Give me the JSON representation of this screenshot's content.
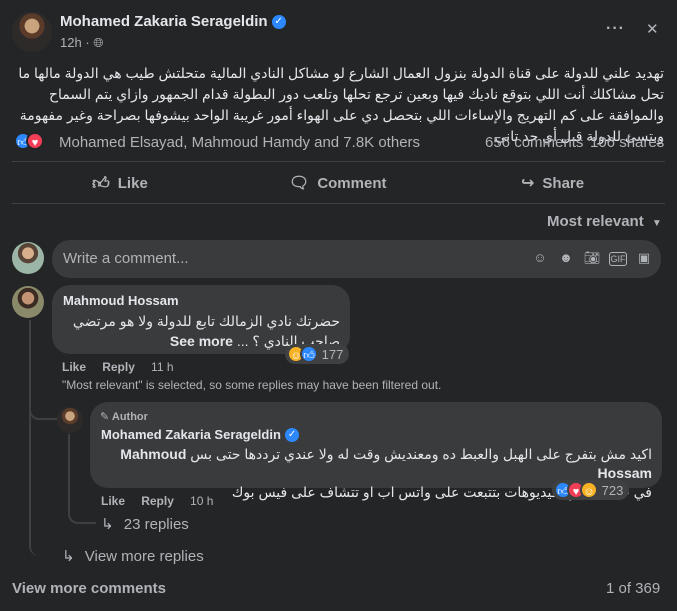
{
  "post": {
    "author": "Mohamed Zakaria Serageldin",
    "time": "12h",
    "privacy_sep": "·",
    "more_label": "···",
    "close_label": "✕",
    "text": "تهديد علني للدولة على قناة الدولة بنزول العمال الشارع لو مشاكل النادي المالية متحلتش طيب هي الدولة مالها ما تحل مشاكلك أنت اللي بتوقع ناديك فيها وبعين ترجع تحلها وتلعب دور البطولة قدام الجمهور وازاي يتم السماح والموافقة على كم التهريج والإساءات اللي بتحصل دي على الهواء أمور غريبة الواحد بيشوفها بصراحة وغير مفهومة وبتسئ للدولة قبل أي حد تاني",
    "reactions_text": "Mohamed Elsayad, Mahmoud Hamdy and 7.8K others",
    "comments_count": "656 comments",
    "shares_count": "106 shares"
  },
  "actions": {
    "like": "Like",
    "comment": "Comment",
    "share": "Share"
  },
  "sort": {
    "label": "Most relevant"
  },
  "composer": {
    "placeholder": "Write a comment..."
  },
  "comments": [
    {
      "author": "Mahmoud Hossam",
      "text": "حضرتك نادي الزمالك تابع للدولة ولا هو مرتضي صاحب النادي ؟ ...",
      "see_more": "See more",
      "reaction_count": "177",
      "like": "Like",
      "reply": "Reply",
      "time": "11 h",
      "filter_note": "\"Most relevant\" is selected, so some replies may have been filtered out.",
      "reply_item": {
        "badge": "Author",
        "author": "Mohamed Zakaria Serageldin",
        "mention": "Mahmoud Hossam",
        "text_line1": "اكيد مش بتفرج على الهبل والعبط ده ومعنديش وقت له ولا عندي ترددها حتى بس",
        "text_line2": "في حاجة اسمها فيديوهات بتتبعت على واتس اب او تتشاف على فيس بوك",
        "reaction_count": "723",
        "like": "Like",
        "reply": "Reply",
        "time": "10 h",
        "more_replies": "23 replies"
      },
      "view_more_replies": "View more replies"
    }
  ],
  "footer": {
    "view_more": "View more comments",
    "pager": "1 of 369"
  },
  "colors": {
    "background": "#242526",
    "bubble": "#3a3b3c",
    "accent": "#2d88ff",
    "love": "#f33e58",
    "haha": "#f7b125"
  }
}
